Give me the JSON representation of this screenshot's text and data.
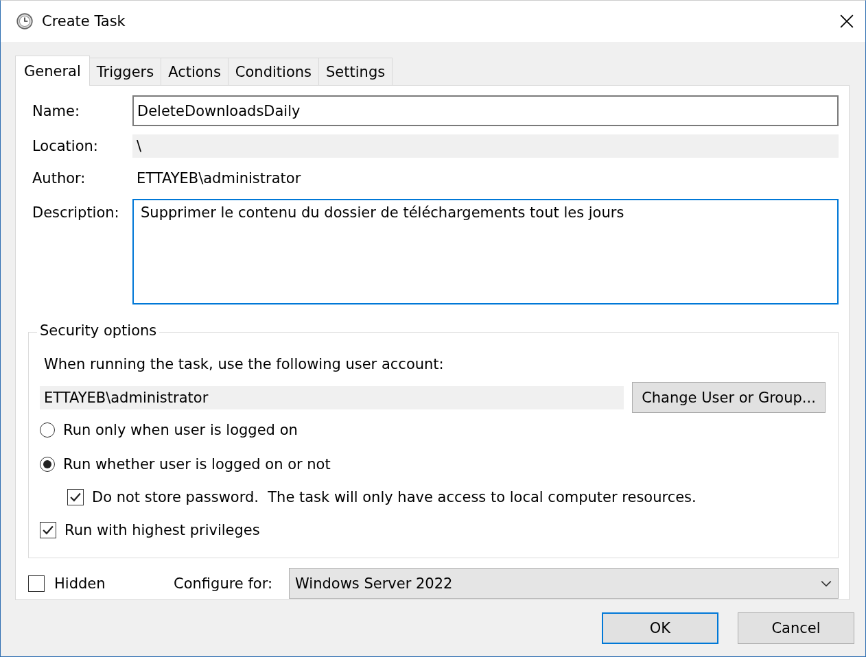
{
  "window": {
    "title": "Create Task"
  },
  "tabs": [
    {
      "label": "General",
      "selected": true
    },
    {
      "label": "Triggers",
      "selected": false
    },
    {
      "label": "Actions",
      "selected": false
    },
    {
      "label": "Conditions",
      "selected": false
    },
    {
      "label": "Settings",
      "selected": false
    }
  ],
  "general": {
    "name": {
      "label": "Name:",
      "value": "DeleteDownloadsDaily"
    },
    "location": {
      "label": "Location:",
      "value": "\\"
    },
    "author": {
      "label": "Author:",
      "value": "ETTAYEB\\administrator"
    },
    "description": {
      "label": "Description:",
      "value": "Supprimer le contenu du dossier de téléchargements tout les jours"
    }
  },
  "security": {
    "title": "Security options",
    "prompt": "When running the task, use the following user account:",
    "account": "ETTAYEB\\administrator",
    "change_button": "Change User or Group...",
    "logon_options": [
      {
        "label": "Run only when user is logged on",
        "selected": false
      },
      {
        "label": "Run whether user is logged on or not",
        "selected": true
      }
    ],
    "do_not_store": {
      "label": "Do not store password.  The task will only have access to local computer resources.",
      "checked": true
    },
    "highest": {
      "label": "Run with highest privileges",
      "checked": true
    }
  },
  "hidden": {
    "label": "Hidden",
    "checked": false
  },
  "configure": {
    "label": "Configure for:",
    "value": "Windows Server 2022"
  },
  "buttons": [
    {
      "label": "OK",
      "default": true
    },
    {
      "label": "Cancel",
      "default": false
    }
  ]
}
